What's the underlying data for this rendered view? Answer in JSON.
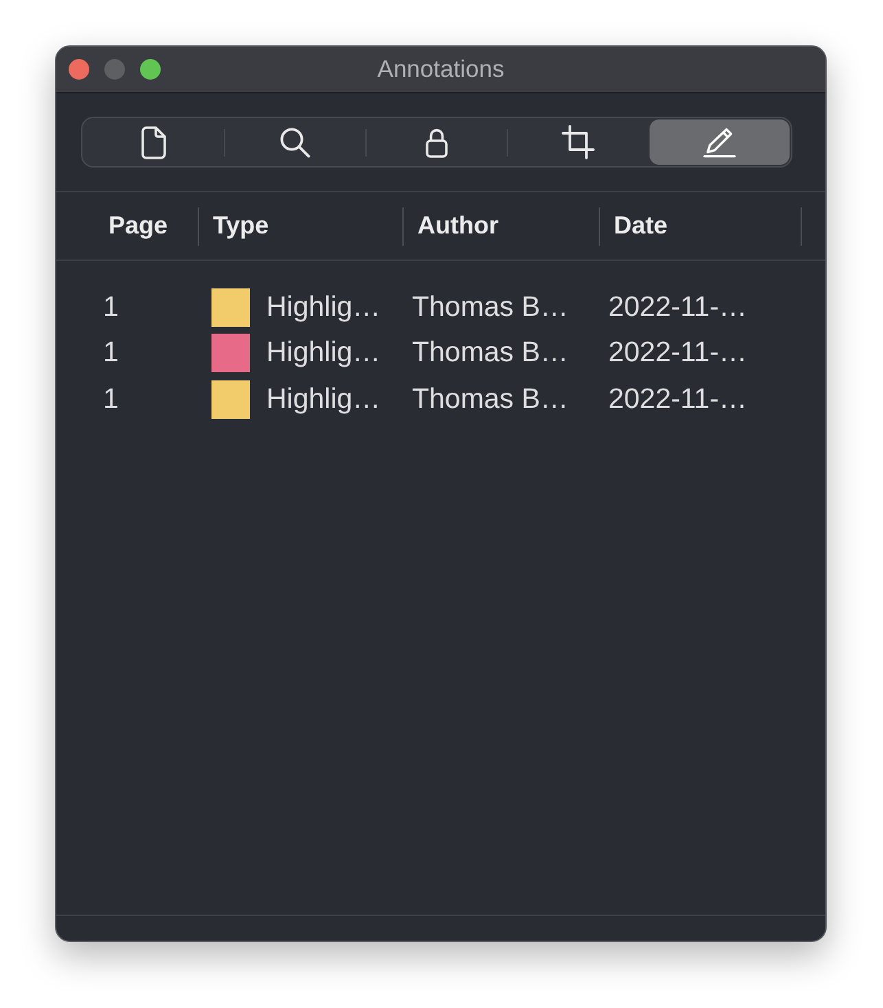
{
  "window": {
    "title": "Annotations",
    "controls": [
      {
        "kind": "close",
        "disabled": false
      },
      {
        "kind": "minimize",
        "disabled": true
      },
      {
        "kind": "zoom",
        "disabled": false
      }
    ]
  },
  "toolbar": {
    "segments": [
      {
        "kind": "document",
        "selected": false
      },
      {
        "kind": "search",
        "selected": false
      },
      {
        "kind": "lock",
        "selected": false
      },
      {
        "kind": "crop",
        "selected": false
      },
      {
        "kind": "pencil",
        "selected": true
      }
    ]
  },
  "table": {
    "columns": [
      "Page",
      "Type",
      "Author",
      "Date"
    ],
    "rows": [
      {
        "page": "1",
        "color": "#f2cc6b",
        "type": "Highlig…",
        "author": "Thomas B…",
        "date": "2022-11-…",
        "selected": false
      },
      {
        "page": "1",
        "color": "#e86a89",
        "type": "Highlig…",
        "author": "Thomas B…",
        "date": "2022-11-…",
        "selected": false
      },
      {
        "page": "1",
        "color": "#f2cc6b",
        "type": "Highlig…",
        "author": "Thomas B…",
        "date": "2022-11-…",
        "selected": false
      }
    ]
  }
}
